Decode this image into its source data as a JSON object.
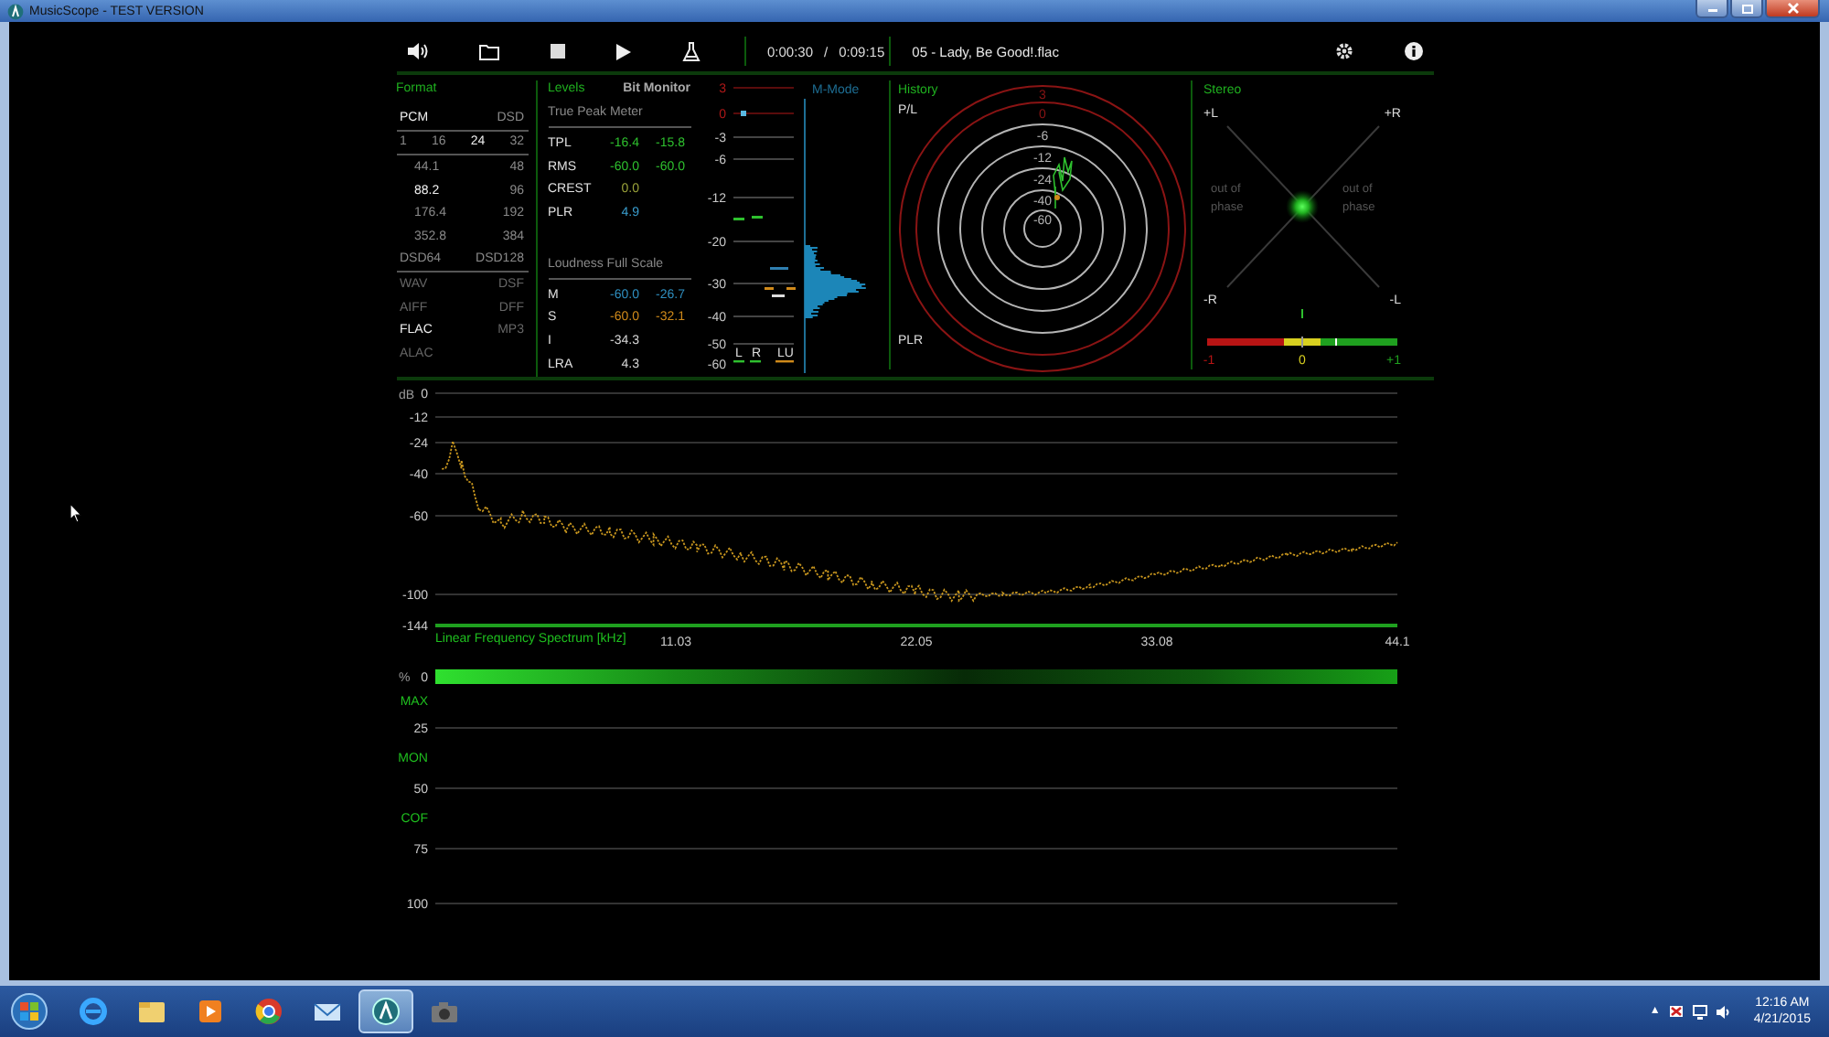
{
  "window": {
    "title": "MusicScope - TEST VERSION"
  },
  "toolbar": {
    "time_elapsed": "0:00:30",
    "time_separator": "/",
    "time_total": "0:09:15",
    "track": "05 - Lady, Be Good!.flac"
  },
  "format": {
    "title": "Format",
    "rows": [
      {
        "kind": "header",
        "items": [
          {
            "label": "PCM",
            "selected": true
          },
          {
            "label": "DSD",
            "selected": false
          }
        ]
      },
      {
        "kind": "bits",
        "items": [
          {
            "label": "1",
            "selected": false
          },
          {
            "label": "16",
            "selected": false
          },
          {
            "label": "24",
            "selected": true
          },
          {
            "label": "32",
            "selected": false
          }
        ]
      },
      {
        "kind": "rate",
        "items": [
          {
            "label": "44.1",
            "selected": false
          },
          {
            "label": "48",
            "selected": false
          }
        ]
      },
      {
        "kind": "rate",
        "items": [
          {
            "label": "88.2",
            "selected": true
          },
          {
            "label": "96",
            "selected": false
          }
        ]
      },
      {
        "kind": "rate",
        "items": [
          {
            "label": "176.4",
            "selected": false
          },
          {
            "label": "192",
            "selected": false
          }
        ]
      },
      {
        "kind": "rate",
        "items": [
          {
            "label": "352.8",
            "selected": false
          },
          {
            "label": "384",
            "selected": false
          }
        ]
      },
      {
        "kind": "dsd",
        "items": [
          {
            "label": "DSD64",
            "selected": false
          },
          {
            "label": "DSD128",
            "selected": false
          }
        ]
      },
      {
        "kind": "container",
        "items": [
          {
            "label": "WAV",
            "selected": false
          },
          {
            "label": "DSF",
            "selected": false
          }
        ]
      },
      {
        "kind": "container",
        "items": [
          {
            "label": "AIFF",
            "selected": false
          },
          {
            "label": "DFF",
            "selected": false
          }
        ]
      },
      {
        "kind": "container",
        "items": [
          {
            "label": "FLAC",
            "selected": true
          },
          {
            "label": "MP3",
            "selected": false
          }
        ]
      },
      {
        "kind": "container",
        "items": [
          {
            "label": "ALAC",
            "selected": false
          }
        ]
      }
    ]
  },
  "levels": {
    "title": "Levels",
    "tab": "Bit Monitor",
    "sections": [
      {
        "heading": "True Peak Meter",
        "rows": [
          {
            "label": "TPL",
            "values": [
              "-16.4",
              "-15.8"
            ],
            "color": "#2ec02e"
          },
          {
            "label": "RMS",
            "values": [
              "-60.0",
              "-60.0"
            ],
            "color": "#2ec02e"
          },
          {
            "label": "CREST",
            "values": [
              "0.0"
            ],
            "color": "#9aa23a"
          },
          {
            "label": "PLR",
            "values": [
              "4.9"
            ],
            "color": "#3a9fd0"
          }
        ]
      },
      {
        "heading": "Loudness Full Scale",
        "rows": [
          {
            "label": "M",
            "values": [
              "-60.0",
              "-26.7"
            ],
            "color": "#2f8fc0"
          },
          {
            "label": "S",
            "values": [
              "-60.0",
              "-32.1"
            ],
            "color": "#d08a1a"
          },
          {
            "label": "I",
            "values": [
              "-34.3"
            ],
            "color": "#d8d8d8"
          },
          {
            "label": "LRA",
            "values": [
              "4.3"
            ],
            "color": "#d8d8d8"
          }
        ]
      }
    ]
  },
  "meter": {
    "scale": [
      {
        "label": "3",
        "color": "#b01818"
      },
      {
        "label": "0",
        "color": "#b01818"
      },
      {
        "label": "-3",
        "color": "#c8c8c8"
      },
      {
        "label": "-6",
        "color": "#c8c8c8"
      },
      {
        "label": "-12",
        "color": "#c8c8c8"
      },
      {
        "label": "-20",
        "color": "#c8c8c8"
      },
      {
        "label": "-30",
        "color": "#c8c8c8"
      },
      {
        "label": "-40",
        "color": "#c8c8c8"
      },
      {
        "label": "-50",
        "color": "#c8c8c8"
      },
      {
        "label": "-60",
        "color": "#c8c8c8"
      }
    ],
    "channels": [
      {
        "label": "L",
        "color": "#2ec02e"
      },
      {
        "label": "R",
        "color": "#2ec02e"
      },
      {
        "label": "LU",
        "color": "#d08a1a"
      }
    ],
    "mode_label": "M-Mode"
  },
  "history": {
    "title": "History",
    "top_label": "P/L",
    "bottom_label": "PLR",
    "rings": [
      {
        "label": "3",
        "color": "#8a1414"
      },
      {
        "label": "0",
        "color": "#8a1414"
      },
      {
        "label": "-6",
        "color": "#b4b4b4"
      },
      {
        "label": "-12",
        "color": "#b4b4b4"
      },
      {
        "label": "-24",
        "color": "#b4b4b4"
      },
      {
        "label": "-40",
        "color": "#b4b4b4"
      },
      {
        "label": "-60",
        "color": "#b4b4b4"
      }
    ]
  },
  "stereo": {
    "title": "Stereo",
    "corners": [
      "+L",
      "+R",
      "-R",
      "-L"
    ],
    "phase_labels": [
      "out of phase",
      "out of phase"
    ],
    "correlation": {
      "level": 0.68,
      "labels": [
        "-1",
        "0",
        "+1"
      ]
    }
  },
  "spectrum": {
    "title": "Linear Frequency Spectrum [kHz]",
    "unit": "dB",
    "y_labels": [
      "0",
      "-12",
      "-24",
      "-40",
      "-60",
      "-100",
      "-144"
    ],
    "x_labels": [
      "11.03",
      "22.05",
      "33.08",
      "44.1"
    ]
  },
  "usage": {
    "unit": "%",
    "rows": [
      {
        "kind": "tick",
        "label": "0"
      },
      {
        "kind": "marker",
        "label": "MAX"
      },
      {
        "kind": "tick",
        "label": "25"
      },
      {
        "kind": "marker",
        "label": "MON"
      },
      {
        "kind": "tick",
        "label": "50"
      },
      {
        "kind": "marker",
        "label": "COF"
      },
      {
        "kind": "tick",
        "label": "75"
      },
      {
        "kind": "tick",
        "label": "100"
      }
    ]
  },
  "taskbar": {
    "apps": [
      {
        "kind": "ie",
        "selected": false
      },
      {
        "kind": "explorer",
        "selected": false
      },
      {
        "kind": "media",
        "selected": false
      },
      {
        "kind": "chrome",
        "selected": false
      },
      {
        "kind": "mail",
        "selected": false
      },
      {
        "kind": "musicscope",
        "selected": true
      },
      {
        "kind": "camera",
        "selected": false
      }
    ],
    "tray_toggle": "▲",
    "clock": "12:16 AM",
    "date": "4/21/2015"
  }
}
